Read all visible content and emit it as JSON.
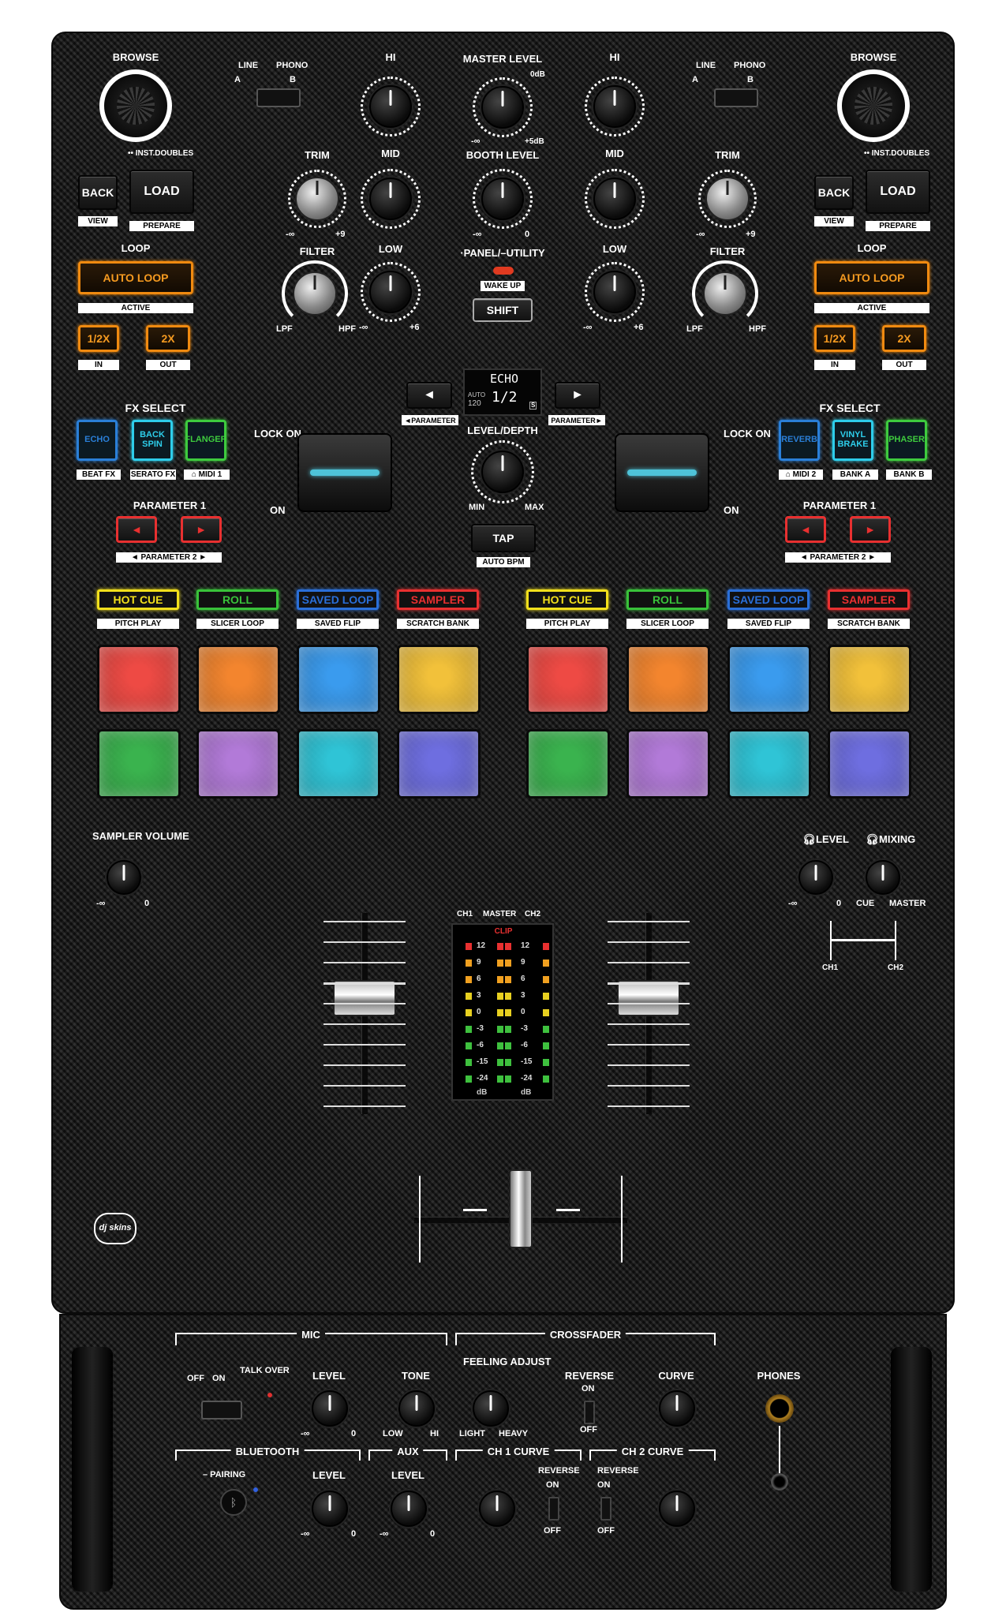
{
  "deck_left": {
    "browse": "BROWSE",
    "inst_doubles": "•• INST.DOUBLES",
    "back": "BACK",
    "view": "VIEW",
    "load": "LOAD",
    "prepare": "PREPARE",
    "loop": "LOOP",
    "auto_loop": "AUTO LOOP",
    "active": "ACTIVE",
    "half": "1/2X",
    "double": "2X",
    "in": "IN",
    "out": "OUT",
    "fx_select": "FX SELECT",
    "fx": [
      {
        "label": "ECHO",
        "color": "#2a7fd8"
      },
      {
        "label": "BACK SPIN",
        "color": "#2ecdea"
      },
      {
        "label": "FLANGER",
        "color": "#3ecb3e"
      }
    ],
    "fx_sub": [
      "BEAT FX",
      "SERATO FX",
      "⌂ MIDI 1"
    ],
    "lock_on": "LOCK ON",
    "on": "ON",
    "param1": "PARAMETER 1",
    "param2": "◄ PARAMETER 2 ►"
  },
  "deck_right": {
    "browse": "BROWSE",
    "inst_doubles": "•• INST.DOUBLES",
    "back": "BACK",
    "view": "VIEW",
    "load": "LOAD",
    "prepare": "PREPARE",
    "loop": "LOOP",
    "auto_loop": "AUTO LOOP",
    "active": "ACTIVE",
    "half": "1/2X",
    "double": "2X",
    "in": "IN",
    "out": "OUT",
    "fx_select": "FX SELECT",
    "fx": [
      {
        "label": "REVERB",
        "color": "#2a7fd8"
      },
      {
        "label": "VINYL BRAKE",
        "color": "#2ecdea"
      },
      {
        "label": "PHASER",
        "color": "#3ecb3e"
      }
    ],
    "fx_sub": [
      "⌂ MIDI 2",
      "BANK A",
      "BANK B"
    ],
    "lock_on": "LOCK ON",
    "on": "ON",
    "param1": "PARAMETER 1",
    "param2": "◄ PARAMETER 2 ►"
  },
  "channel": {
    "line": "LINE",
    "phono": "PHONO",
    "a": "A",
    "b": "B",
    "hi": "HI",
    "mid": "MID",
    "low": "LOW",
    "trim": "TRIM",
    "filter": "FILTER",
    "lpf": "LPF",
    "hpf": "HPF",
    "minus_inf": "-∞",
    "plus6": "+6",
    "plus9": "+9",
    "zero": "0"
  },
  "center": {
    "master_level": "MASTER LEVEL",
    "master_0db": "0dB",
    "master_5db": "+5dB",
    "booth_level": "BOOTH LEVEL",
    "panel_utility": "·PANEL/–UTILITY",
    "wake_up": "WAKE UP",
    "shift": "SHIFT",
    "display_effect": "ECHO",
    "display_auto": "AUTO",
    "display_bpm": "120",
    "display_beat": "1/2",
    "display_icon": "S",
    "param_left": "◄PARAMETER",
    "param_right": "PARAMETER►",
    "prev_arrow": "◄",
    "next_arrow": "►",
    "level_depth": "LEVEL/DEPTH",
    "min": "MIN",
    "max": "MAX",
    "tap": "TAP",
    "auto_bpm": "AUTO BPM"
  },
  "pad_modes": [
    {
      "label": "HOT CUE",
      "sub": "PITCH PLAY",
      "color": "#f2e01c"
    },
    {
      "label": "ROLL",
      "sub": "SLICER LOOP",
      "color": "#39c23a"
    },
    {
      "label": "SAVED LOOP",
      "sub": "SAVED FLIP",
      "color": "#2a6fd8"
    },
    {
      "label": "SAMPLER",
      "sub": "SCRATCH BANK",
      "color": "#e83030"
    }
  ],
  "pad_colors_row1": [
    "#ee4a44",
    "#f3852e",
    "#3a9bee",
    "#f2c13a"
  ],
  "pad_colors_row2": [
    "#3ab34e",
    "#b27ad8",
    "#2fc4d6",
    "#6e6ee0"
  ],
  "sampler": {
    "label": "SAMPLER VOLUME",
    "min": "-∞",
    "max": "0"
  },
  "phones_top": {
    "level": "LEVEL",
    "mixing": "MIXING",
    "cue": "CUE",
    "master": "MASTER",
    "min": "-∞",
    "max": "0",
    "ch1": "CH1",
    "ch2": "CH2"
  },
  "meter": {
    "ch1": "CH1",
    "master": "MASTER",
    "ch2": "CH2",
    "clip": "CLIP",
    "scale": [
      "12",
      "9",
      "6",
      "3",
      "0",
      "-3",
      "-6",
      "-15",
      "-24"
    ],
    "db": "dB"
  },
  "front": {
    "mic": "MIC",
    "crossfader": "CROSSFADER",
    "phones": "PHONES",
    "off": "OFF",
    "on": "ON",
    "talk_over": "TALK OVER",
    "level": "LEVEL",
    "tone": "TONE",
    "low": "LOW",
    "hi": "HI",
    "feeling_adjust": "FEELING ADJUST",
    "light": "LIGHT",
    "heavy": "HEAVY",
    "reverse": "REVERSE",
    "curve": "CURVE",
    "bluetooth": "BLUETOOTH",
    "pairing": "– PAIRING",
    "aux": "AUX",
    "ch1_curve": "CH 1 CURVE",
    "ch2_curve": "CH 2 CURVE",
    "minus_inf": "-∞",
    "zero": "0"
  },
  "logo": "dj skins"
}
